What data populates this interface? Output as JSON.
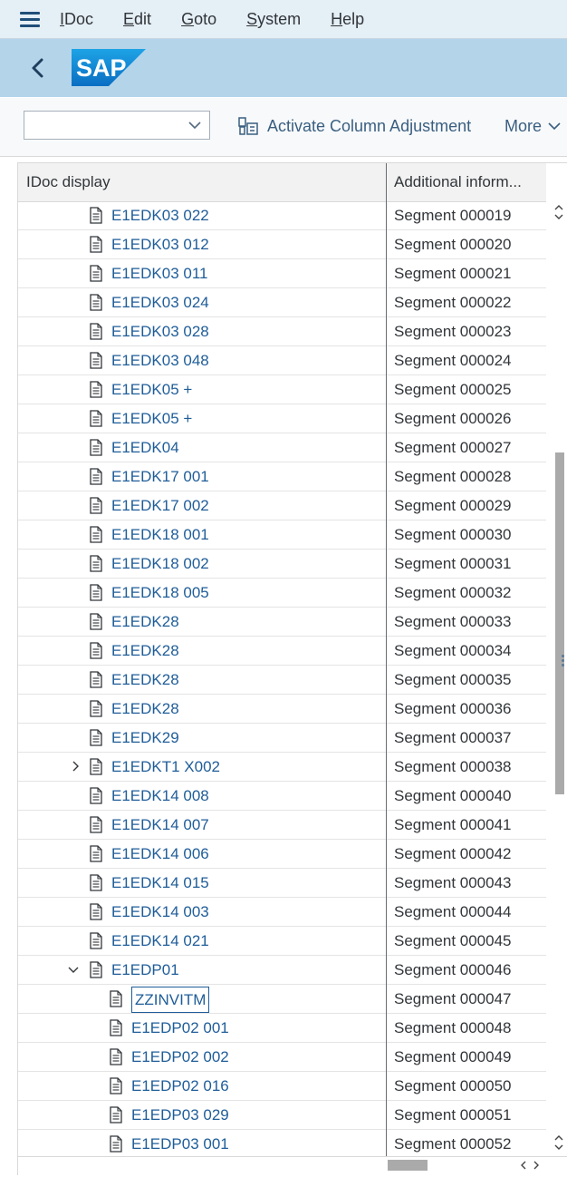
{
  "menubar": {
    "items": [
      {
        "label_u": "I",
        "label_rest": "Doc"
      },
      {
        "label_u": "E",
        "label_rest": "dit"
      },
      {
        "label_u": "G",
        "label_rest": "oto"
      },
      {
        "label_u": "S",
        "label_rest": "ystem"
      },
      {
        "label_u": "H",
        "label_rest": "elp"
      }
    ]
  },
  "shell": {
    "logo_text": "SAP"
  },
  "toolbar": {
    "combo_value": "",
    "activate_label": "Activate Column Adjustment",
    "more_label": "More"
  },
  "table": {
    "headers": [
      "IDoc display",
      "Additional inform..."
    ],
    "rows": [
      {
        "label": "E1EDK03 022",
        "info": "Segment 000019",
        "level": 2,
        "expander": "none"
      },
      {
        "label": "E1EDK03 012",
        "info": "Segment 000020",
        "level": 2,
        "expander": "none"
      },
      {
        "label": "E1EDK03 011",
        "info": "Segment 000021",
        "level": 2,
        "expander": "none"
      },
      {
        "label": "E1EDK03 024",
        "info": "Segment 000022",
        "level": 2,
        "expander": "none"
      },
      {
        "label": "E1EDK03 028",
        "info": "Segment 000023",
        "level": 2,
        "expander": "none"
      },
      {
        "label": "E1EDK03 048",
        "info": "Segment 000024",
        "level": 2,
        "expander": "none"
      },
      {
        "label": "E1EDK05 +",
        "info": "Segment 000025",
        "level": 2,
        "expander": "none"
      },
      {
        "label": "E1EDK05 +",
        "info": "Segment 000026",
        "level": 2,
        "expander": "none"
      },
      {
        "label": "E1EDK04",
        "info": "Segment 000027",
        "level": 2,
        "expander": "none"
      },
      {
        "label": "E1EDK17 001",
        "info": "Segment 000028",
        "level": 2,
        "expander": "none"
      },
      {
        "label": "E1EDK17 002",
        "info": "Segment 000029",
        "level": 2,
        "expander": "none"
      },
      {
        "label": "E1EDK18 001",
        "info": "Segment 000030",
        "level": 2,
        "expander": "none"
      },
      {
        "label": "E1EDK18 002",
        "info": "Segment 000031",
        "level": 2,
        "expander": "none"
      },
      {
        "label": "E1EDK18 005",
        "info": "Segment 000032",
        "level": 2,
        "expander": "none"
      },
      {
        "label": "E1EDK28",
        "info": "Segment 000033",
        "level": 2,
        "expander": "none"
      },
      {
        "label": "E1EDK28",
        "info": "Segment 000034",
        "level": 2,
        "expander": "none"
      },
      {
        "label": "E1EDK28",
        "info": "Segment 000035",
        "level": 2,
        "expander": "none"
      },
      {
        "label": "E1EDK28",
        "info": "Segment 000036",
        "level": 2,
        "expander": "none"
      },
      {
        "label": "E1EDK29",
        "info": "Segment 000037",
        "level": 2,
        "expander": "none"
      },
      {
        "label": "E1EDKT1 X002",
        "info": "Segment 000038",
        "level": 2,
        "expander": "collapsed"
      },
      {
        "label": "E1EDK14 008",
        "info": "Segment 000040",
        "level": 2,
        "expander": "none"
      },
      {
        "label": "E1EDK14 007",
        "info": "Segment 000041",
        "level": 2,
        "expander": "none"
      },
      {
        "label": "E1EDK14 006",
        "info": "Segment 000042",
        "level": 2,
        "expander": "none"
      },
      {
        "label": "E1EDK14 015",
        "info": "Segment 000043",
        "level": 2,
        "expander": "none"
      },
      {
        "label": "E1EDK14 003",
        "info": "Segment 000044",
        "level": 2,
        "expander": "none"
      },
      {
        "label": "E1EDK14 021",
        "info": "Segment 000045",
        "level": 2,
        "expander": "none"
      },
      {
        "label": "E1EDP01",
        "info": "Segment 000046",
        "level": 2,
        "expander": "expanded"
      },
      {
        "label": "ZZINVITM",
        "info": "Segment 000047",
        "level": 3,
        "expander": "none",
        "focused": true
      },
      {
        "label": "E1EDP02 001",
        "info": "Segment 000048",
        "level": 3,
        "expander": "none"
      },
      {
        "label": "E1EDP02 002",
        "info": "Segment 000049",
        "level": 3,
        "expander": "none"
      },
      {
        "label": "E1EDP02 016",
        "info": "Segment 000050",
        "level": 3,
        "expander": "none"
      },
      {
        "label": "E1EDP03 029",
        "info": "Segment 000051",
        "level": 3,
        "expander": "none"
      },
      {
        "label": "E1EDP03 001",
        "info": "Segment 000052",
        "level": 3,
        "expander": "none"
      }
    ]
  },
  "colors": {
    "menubar_bg": "#e5eff6",
    "shell_bg": "#b4d4ea",
    "link": "#1f5d99",
    "logo_blue": "#1a8fd6"
  }
}
